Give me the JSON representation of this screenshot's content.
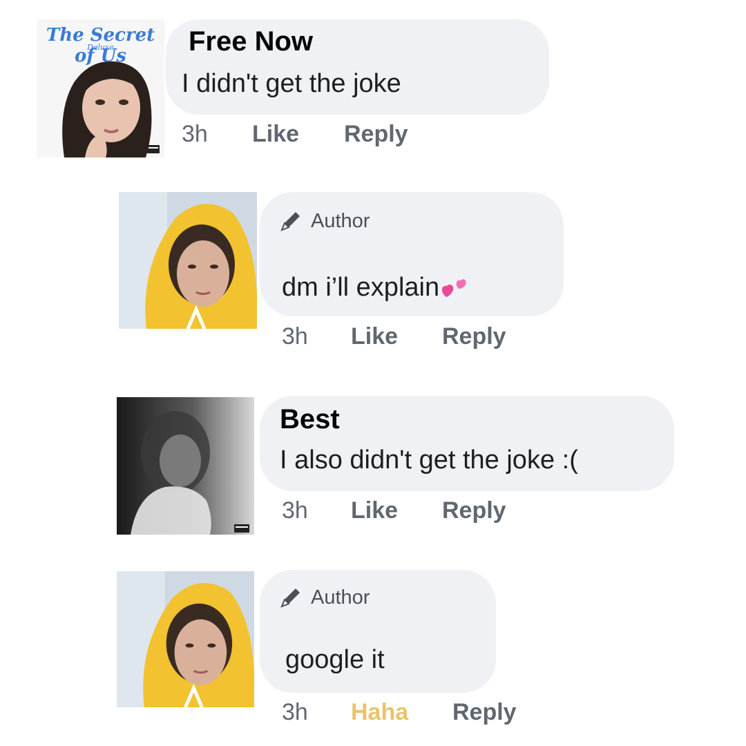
{
  "comments": [
    {
      "name": "Free Now",
      "text": "I didn't get the joke",
      "time": "3h",
      "like": "Like",
      "reply": "Reply",
      "avatar": {
        "title": "The Secret of Us",
        "subtitle": "Deluxe"
      }
    },
    {
      "author_label": "Author",
      "text": "dm i’ll explain",
      "emoji": "pink-hearts",
      "time": "3h",
      "like": "Like",
      "reply": "Reply"
    },
    {
      "name": "Best",
      "text": "I also didn't get the joke :(",
      "time": "3h",
      "like": "Like",
      "reply": "Reply"
    },
    {
      "author_label": "Author",
      "text": "google it",
      "time": "3h",
      "reaction": "Haha",
      "reply": "Reply"
    }
  ],
  "colors": {
    "bubble": "#eff1f4",
    "meta": "#606770",
    "haha": "#e9c46a",
    "album_title": "#3a7bd5",
    "hoodie": "#f2c230"
  }
}
